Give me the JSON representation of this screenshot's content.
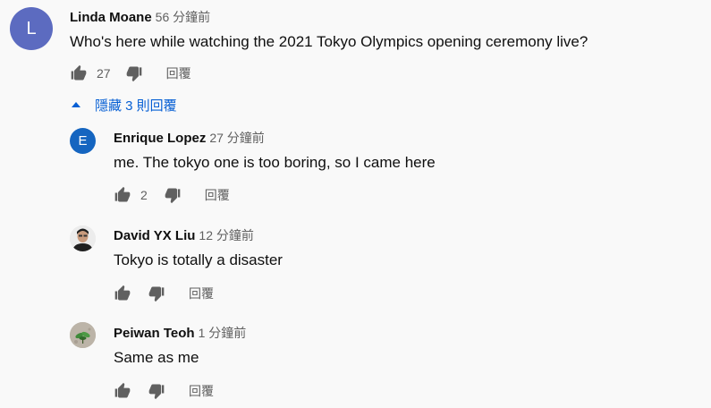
{
  "comments": [
    {
      "author": "Linda Moane",
      "time": "56 分鐘前",
      "text": "Who's here while watching the 2021 Tokyo Olympics opening ceremony live?",
      "likes": "27",
      "reply_label": "回覆",
      "avatar": {
        "letter": "L",
        "color": "#5c6bc0"
      }
    }
  ],
  "replies_toggle": {
    "label": "隱藏 3 則回覆"
  },
  "replies": [
    {
      "author": "Enrique Lopez",
      "time": "27 分鐘前",
      "text": "me. The tokyo one is too boring, so I came here",
      "likes": "2",
      "reply_label": "回覆",
      "avatar": {
        "letter": "E",
        "color": "#1565c0"
      }
    },
    {
      "author": "David YX Liu",
      "time": "12 分鐘前",
      "text": "Tokyo is totally a disaster",
      "likes": "",
      "reply_label": "回覆",
      "avatar": {
        "kind": "photo-person"
      }
    },
    {
      "author": "Peiwan Teoh",
      "time": "1 分鐘前",
      "text": "Same as me",
      "likes": "",
      "reply_label": "回覆",
      "avatar": {
        "kind": "photo-plant"
      }
    }
  ]
}
